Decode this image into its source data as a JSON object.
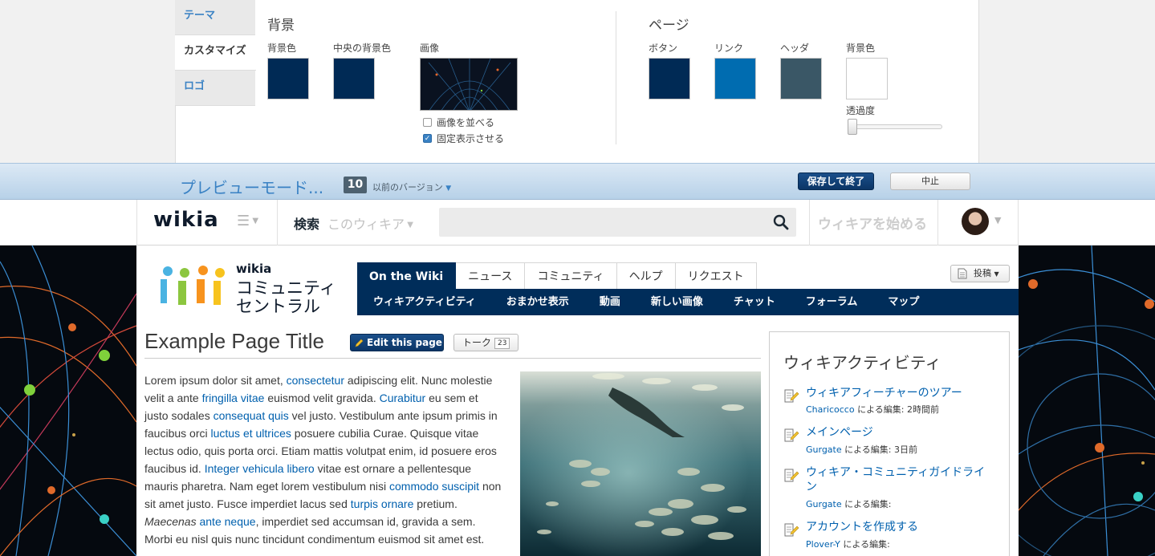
{
  "designer": {
    "tabs": [
      {
        "label": "テーマ",
        "active": false
      },
      {
        "label": "カスタマイズ",
        "active": true
      },
      {
        "label": "ロゴ",
        "active": false
      }
    ],
    "background": {
      "title": "背景",
      "swatches": [
        {
          "label": "背景色",
          "color": "#002a55"
        },
        {
          "label": "中央の背景色",
          "color": "#002a55"
        }
      ],
      "image_label": "画像",
      "tile_image": {
        "label": "画像を並べる",
        "checked": false
      },
      "fixed": {
        "label": "固定表示させる",
        "checked": true
      }
    },
    "page": {
      "title": "ページ",
      "swatches": [
        {
          "label": "ボタン",
          "color": "#002a55"
        },
        {
          "label": "リンク",
          "color": "#006cb0"
        },
        {
          "label": "ヘッダ",
          "color": "#3a5766"
        },
        {
          "label": "背景色",
          "color": "#ffffff"
        }
      ],
      "opacity_label": "透過度",
      "opacity": 0.0
    }
  },
  "preview": {
    "title": "プレビューモード...",
    "version_count": "10",
    "version_label": "以前のバージョン",
    "save_label": "保存して終了",
    "cancel_label": "中止"
  },
  "globalnav": {
    "logo": "wikia",
    "search_label": "検索",
    "search_scope": "このウィキア",
    "search_value": "",
    "start_wiki": "ウィキアを始める"
  },
  "wiki": {
    "wordmark_top": "wikia",
    "wordmark_line1": "コミュニティ",
    "wordmark_line2": "セントラル",
    "tabs": [
      {
        "label": "On the Wiki",
        "active": true
      },
      {
        "label": "ニュース",
        "active": false
      },
      {
        "label": "コミュニティ",
        "active": false
      },
      {
        "label": "ヘルプ",
        "active": false
      },
      {
        "label": "リクエスト",
        "active": false
      }
    ],
    "subnav": [
      "ウィキアクティビティ",
      "おまかせ表示",
      "動画",
      "新しい画像",
      "チャット",
      "フォーラム",
      "マップ"
    ],
    "post_label": "投稿"
  },
  "article": {
    "title": "Example Page Title",
    "edit_label": "Edit this page",
    "talk_label": "トーク",
    "talk_count": "23",
    "body": [
      {
        "t": "text",
        "v": "Lorem ipsum dolor sit amet, "
      },
      {
        "t": "link",
        "v": "consectetur"
      },
      {
        "t": "text",
        "v": " adipiscing elit. Nunc molestie velit a ante "
      },
      {
        "t": "link",
        "v": "fringilla vitae"
      },
      {
        "t": "text",
        "v": " euismod velit gravida. "
      },
      {
        "t": "link",
        "v": "Curabitur"
      },
      {
        "t": "text",
        "v": " eu sem et justo sodales "
      },
      {
        "t": "link",
        "v": "consequat quis"
      },
      {
        "t": "text",
        "v": " vel justo. Vestibulum ante ipsum primis in faucibus orci "
      },
      {
        "t": "link",
        "v": "luctus et ultrices"
      },
      {
        "t": "text",
        "v": " posuere cubilia Curae. Quisque vitae lectus odio, quis porta orci. Etiam mattis volutpat enim, id posuere eros faucibus id. "
      },
      {
        "t": "link",
        "v": "Integer vehicula libero"
      },
      {
        "t": "text",
        "v": " vitae est ornare a pellentesque mauris pharetra. Nam eget lorem vestibulum nisi "
      },
      {
        "t": "link",
        "v": "commodo suscipit"
      },
      {
        "t": "text",
        "v": " non sit amet justo. Fusce imperdiet lacus sed "
      },
      {
        "t": "link",
        "v": "turpis ornare"
      },
      {
        "t": "text",
        "v": " pretium. "
      },
      {
        "t": "em",
        "v": "Maecenas"
      },
      {
        "t": "text",
        "v": " "
      },
      {
        "t": "link",
        "v": "ante neque"
      },
      {
        "t": "text",
        "v": ", imperdiet sed accumsan id, gravida a sem. Morbi eu nisl quis nunc tincidunt condimentum euismod sit amet est."
      }
    ]
  },
  "rail": {
    "title": "ウィキアクティビティ",
    "items": [
      {
        "title": "ウィキアフィーチャーのツアー",
        "user": "Charicocco",
        "meta": "による編集: 2時間前"
      },
      {
        "title": "メインページ",
        "user": "Gurgate",
        "meta": "による編集: 3日前"
      },
      {
        "title": "ウィキア・コミュニティガイドライン",
        "user": "Gurgate",
        "meta": "による編集:"
      },
      {
        "title": "アカウントを作成する",
        "user": "Plover-Y",
        "meta": "による編集:"
      }
    ]
  },
  "colors": {
    "accent": "#3a82c4",
    "nav_dark": "#002d5a",
    "link": "#0060ae"
  }
}
